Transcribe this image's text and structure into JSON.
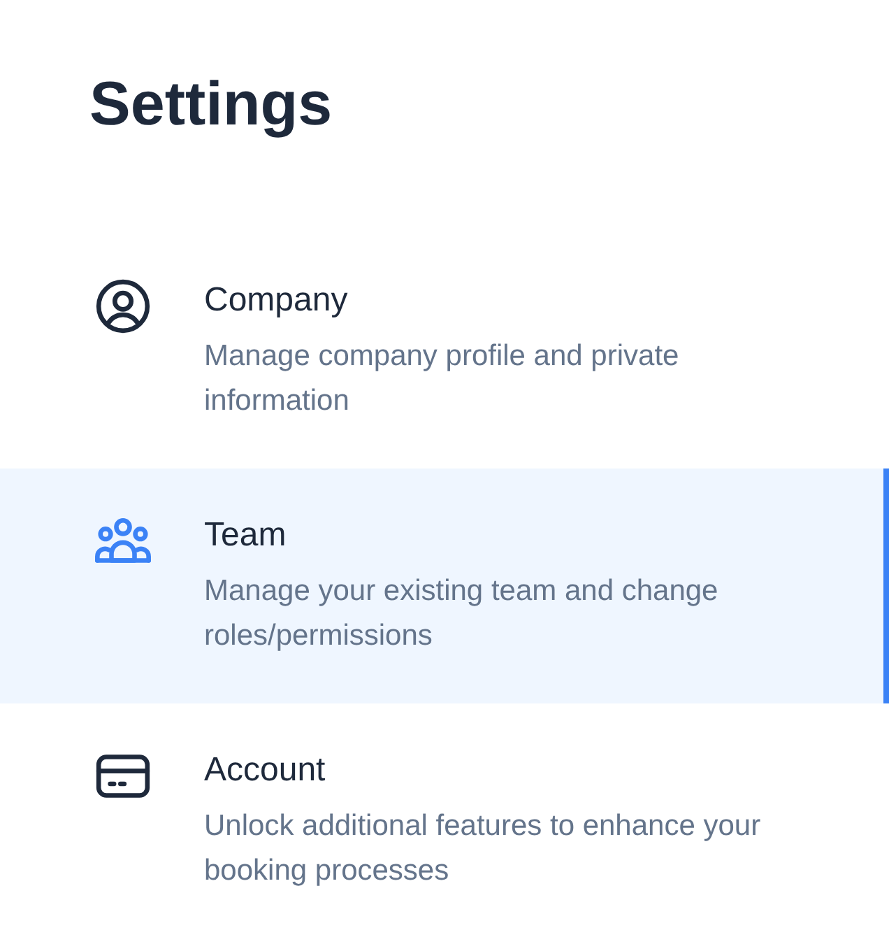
{
  "title": "Settings",
  "items": [
    {
      "label": "Company",
      "description": "Manage company profile and private information",
      "selected": false
    },
    {
      "label": "Team",
      "description": "Manage your existing team and change roles/permissions",
      "selected": true
    },
    {
      "label": "Account",
      "description": "Unlock additional features to enhance your booking processes",
      "selected": false
    }
  ]
}
